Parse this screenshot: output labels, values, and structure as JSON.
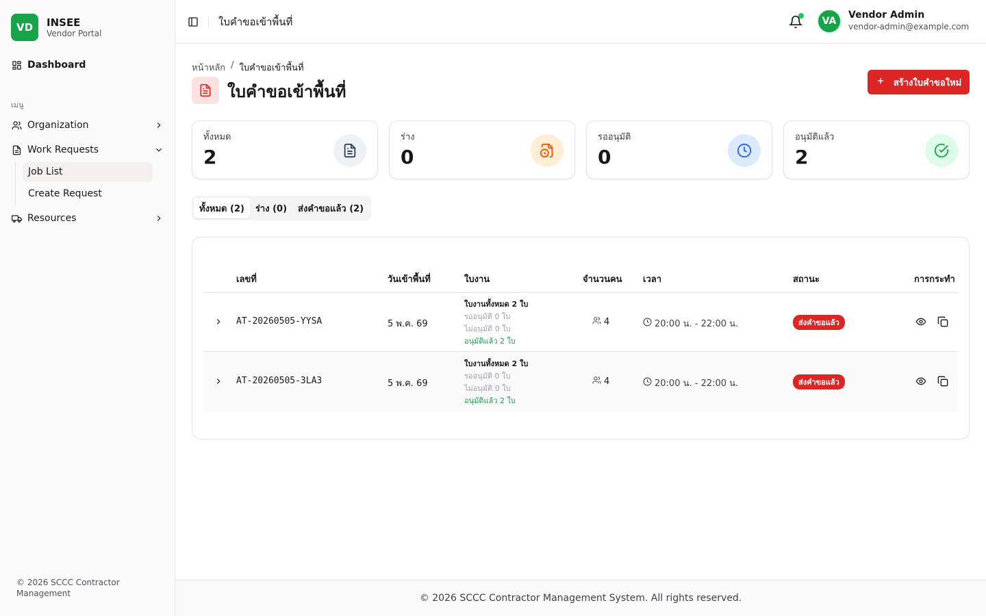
{
  "brand": {
    "logo": "VD",
    "name": "INSEE",
    "sub": "Vendor Portal"
  },
  "sidebar": {
    "dashboard": "Dashboard",
    "group_label": "เมนู",
    "items": [
      {
        "label": "Organization",
        "icon": "users-icon"
      },
      {
        "label": "Work Requests",
        "icon": "file-icon"
      },
      {
        "label": "Resources",
        "icon": "truck-icon"
      }
    ],
    "sub_items": [
      {
        "label": "Job List"
      },
      {
        "label": "Create Request"
      }
    ],
    "footer": "© 2026 SCCC Contractor Management"
  },
  "topbar": {
    "title": "ใบคำขอเข้าพื้นที่",
    "avatar": "VA",
    "user_name": "Vendor Admin",
    "user_email": "vendor-admin@example.com"
  },
  "breadcrumb": {
    "home": "หน้าหลัก",
    "sep": "/",
    "current": "ใบคำขอเข้าพื้นที่"
  },
  "page": {
    "title": "ใบคำขอเข้าพื้นที่",
    "new_button": "สร้างใบคำขอใหม่"
  },
  "stats": [
    {
      "label": "ทั้งหมด",
      "value": "2",
      "icon": "document-icon",
      "color": "#334155",
      "bg": "#eef2f6"
    },
    {
      "label": "ร่าง",
      "value": "0",
      "icon": "file-clock-icon",
      "color": "#ea580c",
      "bg": "#ffedd5"
    },
    {
      "label": "รออนุมัติ",
      "value": "0",
      "icon": "clock-icon",
      "color": "#2563eb",
      "bg": "#dbeafe"
    },
    {
      "label": "อนุมัติแล้ว",
      "value": "2",
      "icon": "check-circle-icon",
      "color": "#16a34a",
      "bg": "#dcfce7"
    }
  ],
  "tabs": [
    {
      "label": "ทั้งหมด (2)"
    },
    {
      "label": "ร่าง (0)"
    },
    {
      "label": "ส่งคำขอแล้ว (2)"
    }
  ],
  "table": {
    "headers": {
      "code": "เลขที่",
      "date": "วันเข้าพื้นที่",
      "jobs": "ใบงาน",
      "people": "จำนวนคน",
      "time": "เวลา",
      "status": "สถานะ",
      "actions": "การกระทำ"
    },
    "rows": [
      {
        "code": "AT-20260505-YYSA",
        "date": "5 พ.ค. 69",
        "jobs_total": "ใบงานทั้งหมด 2 ใบ",
        "jobs_pending": "รออนุมัติ 0 ใบ",
        "jobs_rejected": "ไม่อนุมัติ 0 ใบ",
        "jobs_approved": "อนุมัติแล้ว 2 ใบ",
        "people": "4",
        "time": "20:00 น. - 22:00 น.",
        "status": "ส่งคำขอแล้ว"
      },
      {
        "code": "AT-20260505-3LA3",
        "date": "5 พ.ค. 69",
        "jobs_total": "ใบงานทั้งหมด 2 ใบ",
        "jobs_pending": "รออนุมัติ 0 ใบ",
        "jobs_rejected": "ไม่อนุมัติ 0 ใบ",
        "jobs_approved": "อนุมัติแล้ว 2 ใบ",
        "people": "4",
        "time": "20:00 น. - 22:00 น.",
        "status": "ส่งคำขอแล้ว"
      }
    ]
  },
  "footer": "© 2026 SCCC Contractor Management System. All rights reserved."
}
